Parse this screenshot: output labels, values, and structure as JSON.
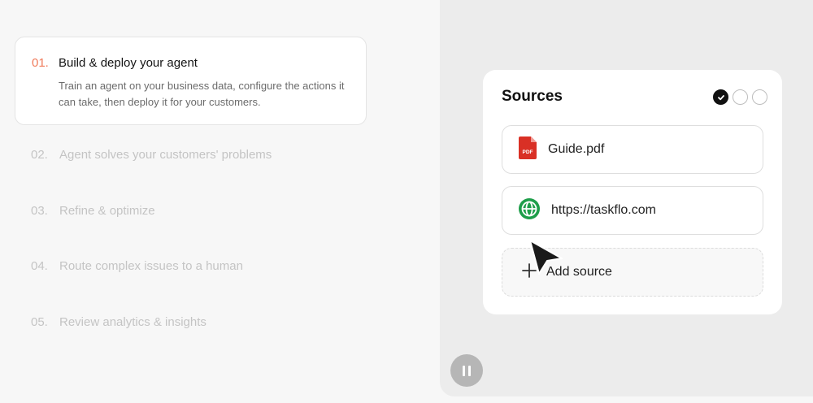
{
  "steps": [
    {
      "number": "01.",
      "title": "Build & deploy your agent",
      "description": "Train an agent on your business data, configure the actions it can take, then deploy it for your customers.",
      "active": true
    },
    {
      "number": "02.",
      "title": "Agent solves your customers' problems",
      "active": false
    },
    {
      "number": "03.",
      "title": "Refine & optimize",
      "active": false
    },
    {
      "number": "04.",
      "title": "Route complex issues to a human",
      "active": false
    },
    {
      "number": "05.",
      "title": "Review analytics & insights",
      "active": false
    }
  ],
  "sources_card": {
    "title": "Sources",
    "progress_dots": [
      "complete",
      "incomplete",
      "incomplete"
    ],
    "items": [
      {
        "label": "Guide.pdf",
        "icon": "pdf-file-icon",
        "icon_text": "PDF"
      },
      {
        "label": "https://taskflo.com",
        "icon": "globe-icon"
      }
    ],
    "add_label": "Add source",
    "add_icon": "plus-icon"
  },
  "media_control": {
    "icon": "pause-icon"
  },
  "colors": {
    "accent": "#f07a5a",
    "pdf_red": "#d93025",
    "globe_green": "#1e9e4a",
    "muted_text": "#c4c4c4"
  }
}
